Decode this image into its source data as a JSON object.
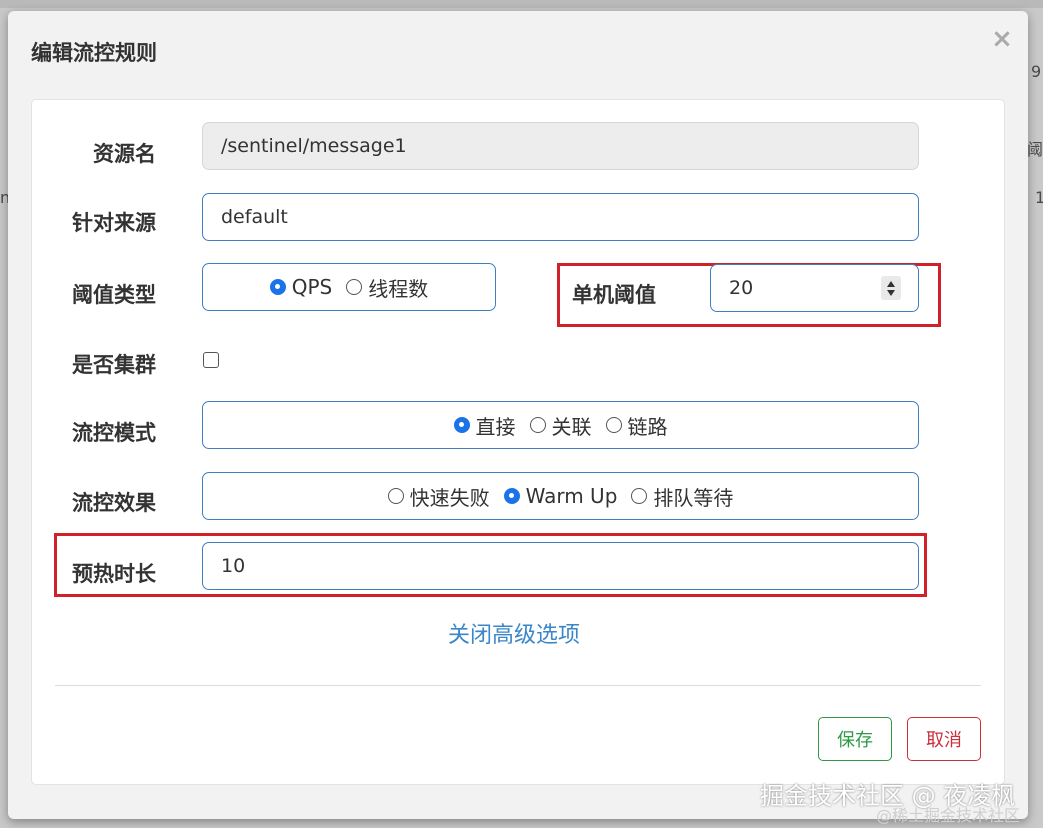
{
  "background": {
    "fragments": [
      "9",
      "阈",
      "nt",
      "1"
    ]
  },
  "dialog": {
    "title": "编辑流控规则",
    "close_icon": "×"
  },
  "form": {
    "resource": {
      "label": "资源名",
      "value": "/sentinel/message1"
    },
    "source": {
      "label": "针对来源",
      "value": "default"
    },
    "threshold_type": {
      "label": "阈值类型",
      "options": [
        "QPS",
        "线程数"
      ],
      "selected": "QPS"
    },
    "single_threshold": {
      "label": "单机阈值",
      "value": "20"
    },
    "cluster": {
      "label": "是否集群",
      "checked": false
    },
    "flow_mode": {
      "label": "流控模式",
      "options": [
        "直接",
        "关联",
        "链路"
      ],
      "selected": "直接"
    },
    "flow_effect": {
      "label": "流控效果",
      "options": [
        "快速失败",
        "Warm Up",
        "排队等待"
      ],
      "selected": "Warm Up"
    },
    "warmup": {
      "label": "预热时长",
      "value": "10"
    },
    "advanced_link": "关闭高级选项"
  },
  "actions": {
    "save": "保存",
    "cancel": "取消"
  },
  "watermark": {
    "main": "掘金技术社区 @ 夜凌枫",
    "sub": "@稀土掘金技术社区"
  },
  "colors": {
    "accent": "#3f7fc1",
    "highlight": "#d0212b",
    "save": "#2e9a45",
    "cancel": "#c9303a",
    "link": "#3a86c8"
  }
}
